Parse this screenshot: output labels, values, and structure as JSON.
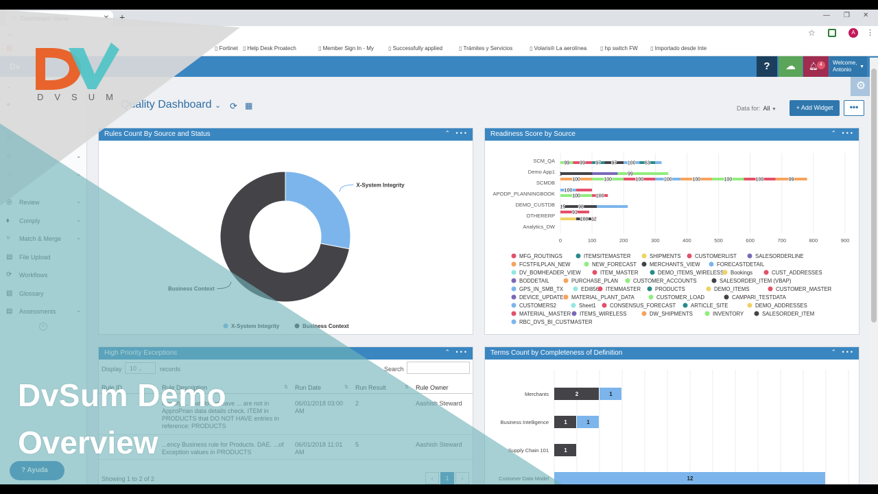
{
  "browser": {
    "tab_title": "Dashboard Home",
    "new_tab": "+",
    "bookmarks": [
      "Fortinet",
      "Help Desk Proatech",
      "Member Sign In - My",
      "Successfully applied",
      "Trámites y Servicios",
      "Volaris® La aerolínea",
      "hp switch FW",
      "Importado desde Inte"
    ],
    "profile_initial": "A"
  },
  "topnav": {
    "brand": "Dv",
    "help": "?",
    "notifications": "4",
    "welcome_line1": "Welcome,",
    "welcome_line2": "Antonio"
  },
  "sidebar": {
    "items": [
      {
        "label": "Review",
        "icon": "review-icon"
      },
      {
        "label": "Comply",
        "icon": "comply-icon"
      },
      {
        "label": "Match & Merge",
        "icon": "merge-icon"
      },
      {
        "label": "File Upload",
        "icon": "file-upload-icon"
      },
      {
        "label": "Workflows",
        "icon": "workflows-icon"
      },
      {
        "label": "Glossary",
        "icon": "glossary-icon"
      },
      {
        "label": "Assessments",
        "icon": "assessments-icon"
      }
    ],
    "help_button": "Ayuda"
  },
  "page": {
    "title": "Quality Dashboard",
    "data_for_label": "Data for:",
    "data_for_value": "All",
    "add_widget": "+ Add Widget",
    "more": "•••"
  },
  "widgets": {
    "rules": {
      "title": "Rules Count By Source and Status"
    },
    "readiness": {
      "title": "Readiness Score by Source"
    },
    "exceptions": {
      "title": "High Priority Exceptions"
    },
    "terms": {
      "title": "Terms Count by Completeness of Definition"
    }
  },
  "exceptions_table": {
    "display_label": "Display",
    "display_value": "10",
    "records_label": "records",
    "search_label": "Search",
    "columns": [
      "Rule ID",
      "Rule Description",
      "Run Date",
      "Run Result",
      "Rule Owner"
    ],
    "rows": [
      {
        "desc": "Identify ... that do not have ... are not in ApproPrian data details check. ITEM in PRODUCTS that DO NOT HAVE entries in reference: PRODUCTS",
        "date": "06/01/2018 03:00 AM",
        "result": "2",
        "owner": "Aashish Steward"
      },
      {
        "desc": "...ency Business rule for Products. DAE. ...of Exception values in PRODUCTS",
        "date": "06/01/2018 11:01 AM",
        "result": "5",
        "owner": "Aashish Steward"
      }
    ],
    "footer": "Showing 1 to 2 of 2",
    "page": "1"
  },
  "overlay": {
    "brand_letters": "DVSUM",
    "title_line1": "DvSum Demo",
    "title_line2": "Overview"
  },
  "chart_data": [
    {
      "type": "pie",
      "donut": true,
      "categories": [
        "X-System Integrity",
        "Business Context"
      ],
      "values": [
        28,
        72
      ],
      "colors": [
        "#7cb5ec",
        "#434348"
      ],
      "legend": "bottom"
    },
    {
      "type": "bar",
      "orientation": "horizontal",
      "stacked": true,
      "categories": [
        "SCM_QA",
        "Demo App1",
        "SCMDB",
        "APODP_PLANNINGBOOK",
        "DEMO_CUSTDB",
        "OTHERERP",
        "Analytics_DW"
      ],
      "segments": [
        [
          {
            "v": 40,
            "c": "#90ed7d",
            "l": "99"
          },
          {
            "v": 60,
            "c": "#e4506a",
            "l": "99"
          },
          {
            "v": 40,
            "c": "#2a8a8a",
            "l": "97"
          },
          {
            "v": 60,
            "c": "#434348",
            "l": "97"
          },
          {
            "v": 50,
            "c": "#7cb5ec",
            "l": "100"
          },
          {
            "v": 50,
            "c": "#2a8a8a",
            "l": "63"
          },
          {
            "v": 20,
            "c": "#7cb5ec",
            "l": ""
          }
        ],
        [
          {
            "v": 1,
            "c": "#434348",
            "l": "1"
          },
          {
            "v": 100,
            "c": "#434348",
            "l": ""
          },
          {
            "v": 80,
            "c": "#7b68b8",
            "l": ""
          },
          {
            "v": 80,
            "c": "#90ed7d",
            "l": "99"
          },
          {
            "v": 80,
            "c": "#90ed7d",
            "l": ""
          }
        ],
        [
          {
            "v": 100,
            "c": "#f7a35c",
            "l": "100"
          },
          {
            "v": 100,
            "c": "#90ed7d",
            "l": "100"
          },
          {
            "v": 100,
            "c": "#e4506a",
            "l": "100"
          },
          {
            "v": 80,
            "c": "#7cb5ec",
            "l": "100"
          },
          {
            "v": 100,
            "c": "#f7a35c",
            "l": "100"
          },
          {
            "v": 100,
            "c": "#90ed7d",
            "l": "100"
          },
          {
            "v": 100,
            "c": "#e4506a",
            "l": "100"
          },
          {
            "v": 100,
            "c": "#f7a35c",
            "l": "99"
          }
        ],
        [
          {
            "v": 50,
            "c": "#7cb5ec",
            "l": "100"
          },
          {
            "v": 50,
            "c": "#e4506a",
            "l": ""
          },
          {
            "v": 0,
            "c": "#7cb5ec",
            "l": ""
          }
        ],
        [
          {
            "v": 100,
            "c": "#90ed7d",
            "l": "100"
          },
          {
            "v": 50,
            "c": "#e4506a",
            "l": "100"
          }
        ],
        [
          {
            "v": 15,
            "c": "#434348",
            "l": "15"
          },
          {
            "v": 100,
            "c": "#434348",
            "l": "98"
          },
          {
            "v": 98,
            "c": "#7cb5ec",
            "l": ""
          }
        ],
        [
          {
            "v": 91,
            "c": "#e4506a",
            "l": "91"
          }
        ],
        [
          {
            "v": 50,
            "c": "#f0d264",
            "l": ""
          },
          {
            "v": 50,
            "c": "#434348",
            "l": "100"
          },
          {
            "v": 12,
            "c": "#e4506a",
            "l": "12"
          }
        ]
      ],
      "x_ticks": [
        0,
        100,
        200,
        300,
        400,
        500,
        600,
        700,
        800,
        900
      ],
      "xlim": [
        0,
        900
      ],
      "legend": [
        {
          "name": "MFG_ROUTINGS",
          "color": "#e4506a"
        },
        {
          "name": "ITEMSITEMASTER",
          "color": "#2a8a8a"
        },
        {
          "name": "SHIPMENTS",
          "color": "#f0d264"
        },
        {
          "name": "CUSTOMERLIST",
          "color": "#e4506a"
        },
        {
          "name": "SALESORDERLINE",
          "color": "#7b68b8"
        },
        {
          "name": "FCSTFILPLAN_NEW",
          "color": "#f7a35c"
        },
        {
          "name": "NEW_FORECAST",
          "color": "#90ed7d"
        },
        {
          "name": "MERCHANTS_VIEW",
          "color": "#434348"
        },
        {
          "name": "FORECASTDETAIL",
          "color": "#7cb5ec"
        },
        {
          "name": "DV_BOMHEADER_VIEW",
          "color": "#91e8e1"
        },
        {
          "name": "ITEM_MASTER",
          "color": "#e4506a"
        },
        {
          "name": "DEMO_ITEMS_WIRELESS",
          "color": "#2a8a8a"
        },
        {
          "name": "Bookings",
          "color": "#f0d264"
        },
        {
          "name": "CUST_ADDRESSES",
          "color": "#e4506a"
        },
        {
          "name": "BODDETAIL",
          "color": "#7b68b8"
        },
        {
          "name": "PURCHASE_PLAN",
          "color": "#f7a35c"
        },
        {
          "name": "CUSTOMER_ACCOUNTS",
          "color": "#90ed7d"
        },
        {
          "name": "SALESORDER_ITEM (VBAP)",
          "color": "#434348"
        },
        {
          "name": "GPS_IN_SMB_TX",
          "color": "#7cb5ec"
        },
        {
          "name": "EDI856",
          "color": "#91e8e1"
        },
        {
          "name": "ITEMMASTER",
          "color": "#e4506a"
        },
        {
          "name": "PRODUCTS",
          "color": "#2a8a8a"
        },
        {
          "name": "DEMO_ITEMS",
          "color": "#f0d264"
        },
        {
          "name": "CUSTOMER_MASTER",
          "color": "#e4506a"
        },
        {
          "name": "DEVICE_UPDATES",
          "color": "#7b68b8"
        },
        {
          "name": "MATERIAL_PLANT_DATA",
          "color": "#f7a35c"
        },
        {
          "name": "CUSTOMER_LOAD",
          "color": "#90ed7d"
        },
        {
          "name": "CAMPARI_TESTDATA",
          "color": "#434348"
        },
        {
          "name": "CUSTOMERS2",
          "color": "#7cb5ec"
        },
        {
          "name": "Sheet1",
          "color": "#91e8e1"
        },
        {
          "name": "CONSENSUS_FORECAST",
          "color": "#e4506a"
        },
        {
          "name": "ARTICLE_SITE",
          "color": "#2a8a8a"
        },
        {
          "name": "DEMO_ADDRESSES",
          "color": "#f0d264"
        },
        {
          "name": "MATERIAL_MASTER",
          "color": "#e4506a"
        },
        {
          "name": "ITEMS_WIRELESS",
          "color": "#7b68b8"
        },
        {
          "name": "DW_SHIPMENTS",
          "color": "#f7a35c"
        },
        {
          "name": "INVENTORY",
          "color": "#90ed7d"
        },
        {
          "name": "SALESORDER_ITEM",
          "color": "#434348"
        },
        {
          "name": "RBC_DVS_BI_CUSTMASTER",
          "color": "#7cb5ec"
        }
      ]
    },
    {
      "type": "bar",
      "orientation": "horizontal",
      "stacked": true,
      "categories": [
        "Merchants",
        "Business Intelligence",
        "Supply Chain 101",
        "Customer Data Model"
      ],
      "series": [
        {
          "values": [
            2,
            1,
            1,
            0
          ],
          "color": "#434348"
        },
        {
          "values": [
            1,
            1,
            0,
            12
          ],
          "color": "#7cb5ec"
        }
      ],
      "xlim": [
        0,
        13
      ]
    }
  ]
}
